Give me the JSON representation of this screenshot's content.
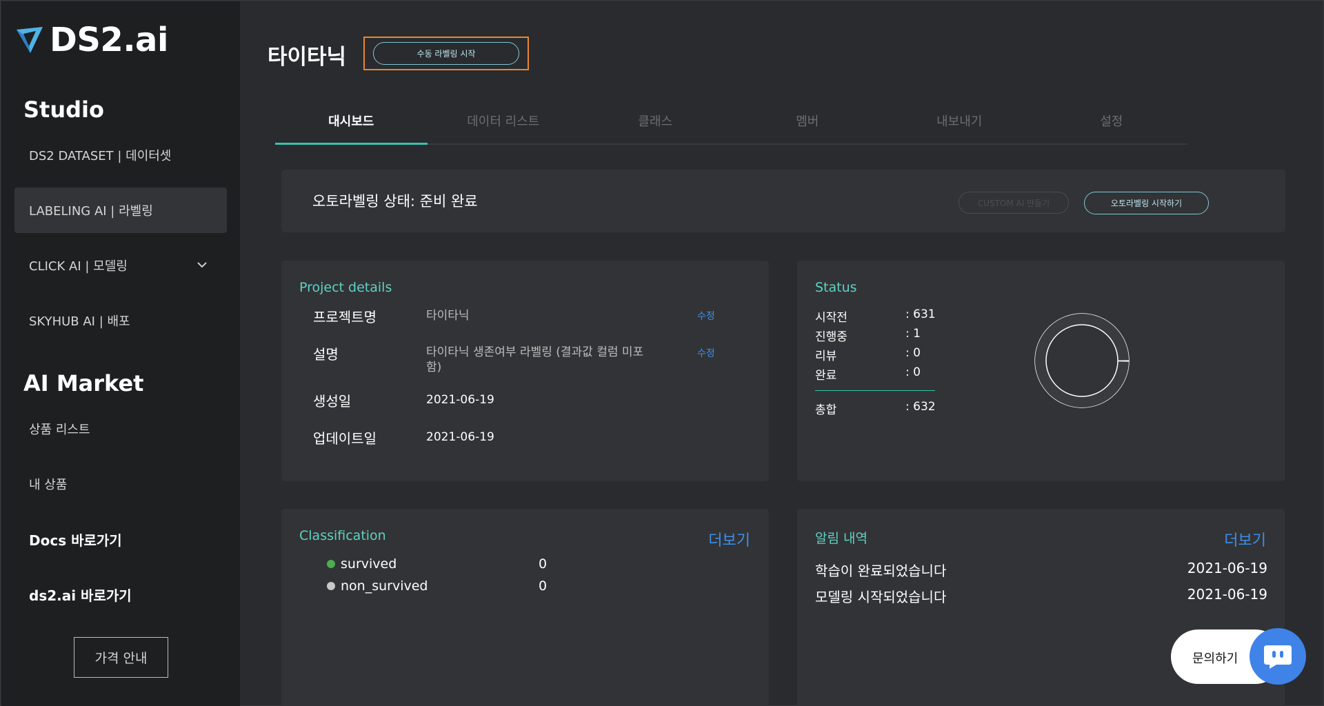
{
  "brand": {
    "name": "DS2.ai",
    "accent": "#36c4ae",
    "link_color": "#3e8fe6"
  },
  "sidebar": {
    "studio_title": "Studio",
    "studio_items": [
      {
        "label": "DS2 DATASET | 데이터셋"
      },
      {
        "label": "LABELING AI | 라벨링"
      },
      {
        "label": "CLICK AI | 모델링"
      },
      {
        "label": "SKYHUB AI | 배포"
      }
    ],
    "market_title": "AI Market",
    "market_items": [
      {
        "label": "상품 리스트"
      },
      {
        "label": "내 상품"
      },
      {
        "label": "Docs 바로가기"
      },
      {
        "label": "ds2.ai 바로가기"
      }
    ],
    "price_button": "가격 안내"
  },
  "header": {
    "title": "타이타닉",
    "manual_label_button": "수동 라벨링 시작"
  },
  "tabs": [
    {
      "label": "대시보드"
    },
    {
      "label": "데이터 리스트"
    },
    {
      "label": "클래스"
    },
    {
      "label": "멤버"
    },
    {
      "label": "내보내기"
    },
    {
      "label": "설정"
    }
  ],
  "auto_labeling": {
    "status_text": "오토라벨링 상태: 준비 완료",
    "custom_ai_button": "CUSTOM AI 만들기",
    "start_button": "오토라벨링 시작하기"
  },
  "project_details": {
    "title": "Project details",
    "rows": [
      {
        "label": "프로젝트명",
        "value": "타이타닉",
        "edit": "수정"
      },
      {
        "label": "설명",
        "value": "타이타닉 생존여부 라벨링 (결과값 컬럼 미포함)",
        "edit": "수정"
      },
      {
        "label": "생성일",
        "value": "2021-06-19"
      },
      {
        "label": "업데이트일",
        "value": "2021-06-19"
      }
    ]
  },
  "status": {
    "title": "Status",
    "rows": [
      {
        "label": "시작전",
        "value": ": 631"
      },
      {
        "label": "진행중",
        "value": ": 1"
      },
      {
        "label": "리뷰",
        "value": ": 0"
      },
      {
        "label": "완료",
        "value": ": 0"
      }
    ],
    "total_label": "총합",
    "total_value": ": 632",
    "counts": {
      "not_started": 631,
      "in_progress": 1,
      "review": 0,
      "done": 0
    }
  },
  "classification": {
    "title": "Classification",
    "more": "더보기",
    "items": [
      {
        "name": "survived",
        "count": "0",
        "color": "#4caf50"
      },
      {
        "name": "non_survived",
        "count": "0",
        "color": "#c8c8c8"
      }
    ]
  },
  "notifications": {
    "title": "알림 내역",
    "more": "더보기",
    "items": [
      {
        "text": "학습이 완료되었습니다",
        "date": "2021-06-19"
      },
      {
        "text": "모델링 시작되었습니다",
        "date": "2021-06-19"
      }
    ]
  },
  "inquiry": {
    "label": "문의하기"
  }
}
